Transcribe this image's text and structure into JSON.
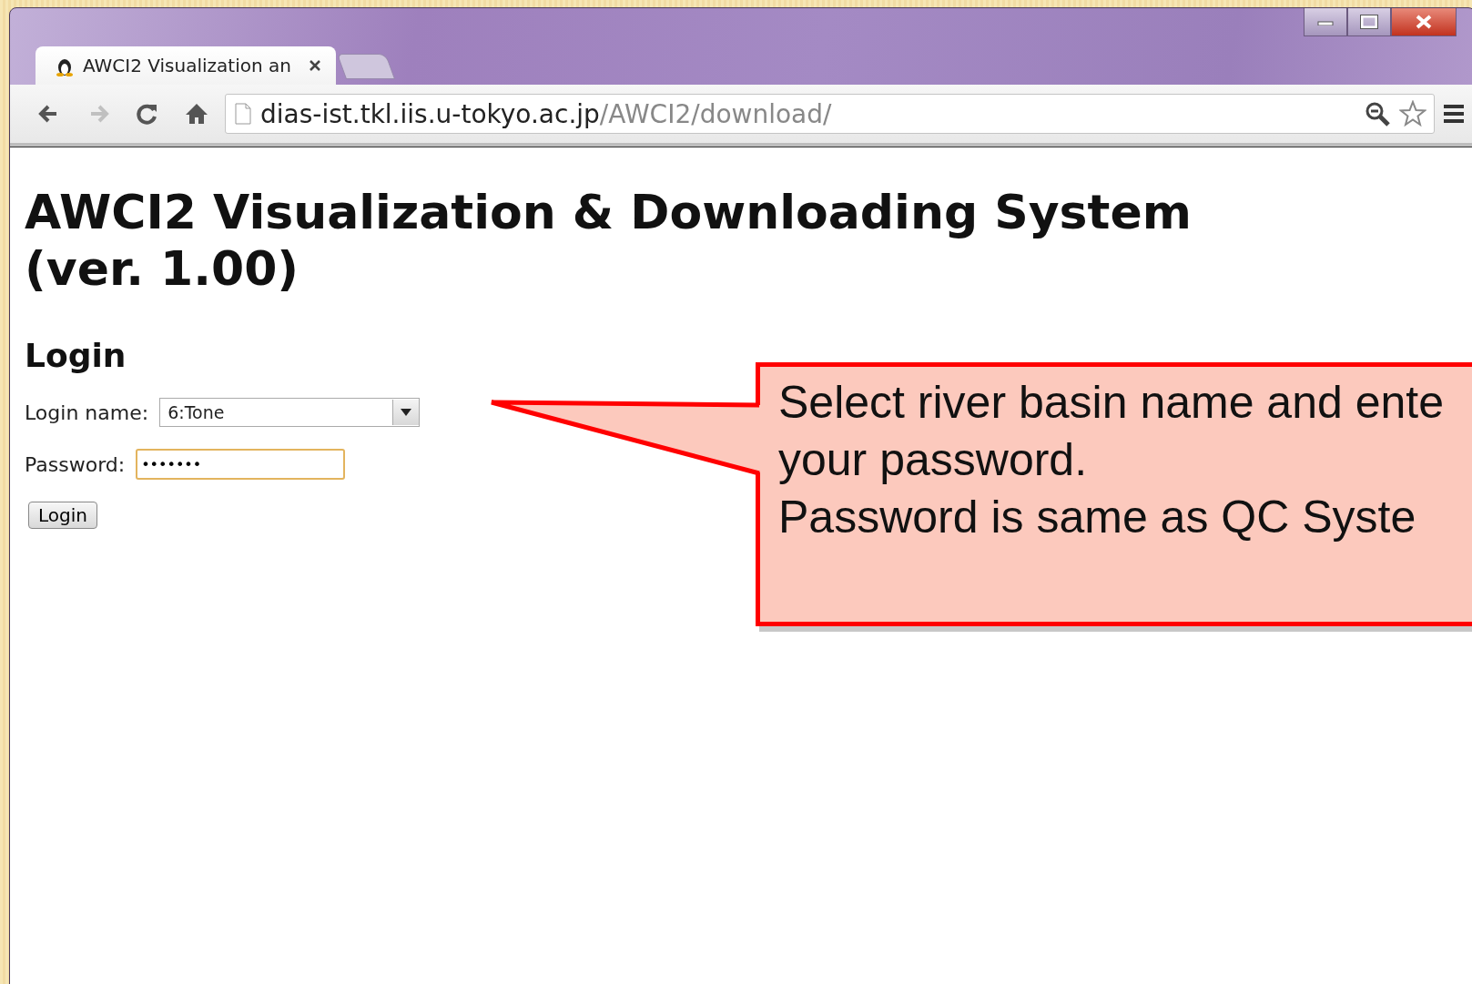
{
  "window": {
    "controls": [
      {
        "kind": "minimize"
      },
      {
        "kind": "maximize"
      },
      {
        "kind": "close"
      }
    ]
  },
  "tabs": [
    {
      "title": "AWCI2 Visualization an",
      "selected": true
    }
  ],
  "toolbar": {
    "buttons": [
      {
        "kind": "back",
        "disabled": false
      },
      {
        "kind": "forward",
        "disabled": true
      },
      {
        "kind": "reload",
        "disabled": false
      },
      {
        "kind": "home",
        "disabled": false
      }
    ],
    "address": {
      "host": "dias-ist.tkl.iis.u-tokyo.ac.jp",
      "path": "/AWCI2/download/"
    }
  },
  "page": {
    "title": "AWCI2 Visualization & Downloading System (ver. 1.00)",
    "section": "Login",
    "fields": [
      {
        "kind": "select",
        "label": "Login name:",
        "value": "6:Tone",
        "focused": false
      },
      {
        "kind": "password",
        "label": "Password:",
        "value": "•••••••",
        "focused": true
      }
    ],
    "button": "Login"
  },
  "callout": {
    "lines": [
      "Select river basin name and ente",
      "your password.",
      "Password is same as QC Syste"
    ]
  }
}
